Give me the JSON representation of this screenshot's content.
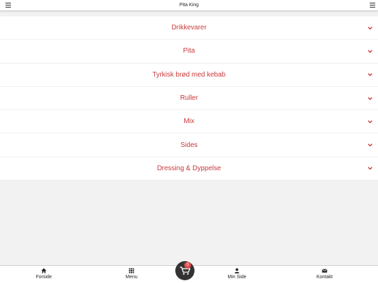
{
  "header": {
    "title": "Pita King"
  },
  "categories": [
    {
      "label": "Drikkevarer"
    },
    {
      "label": "Pita"
    },
    {
      "label": "Tyrkisk brød med kebab"
    },
    {
      "label": "Ruller"
    },
    {
      "label": "Mix"
    },
    {
      "label": "Sides"
    },
    {
      "label": "Dressing & Dyppelse"
    }
  ],
  "bottom_nav": {
    "home_label": "Forside",
    "menu_label": "Menu",
    "cart_count": "0",
    "profile_label": "Min Side",
    "contact_label": "Kontakt"
  },
  "colors": {
    "accent": "#c9383a",
    "badge": "#e24b4b",
    "cart_bg": "#333333"
  }
}
